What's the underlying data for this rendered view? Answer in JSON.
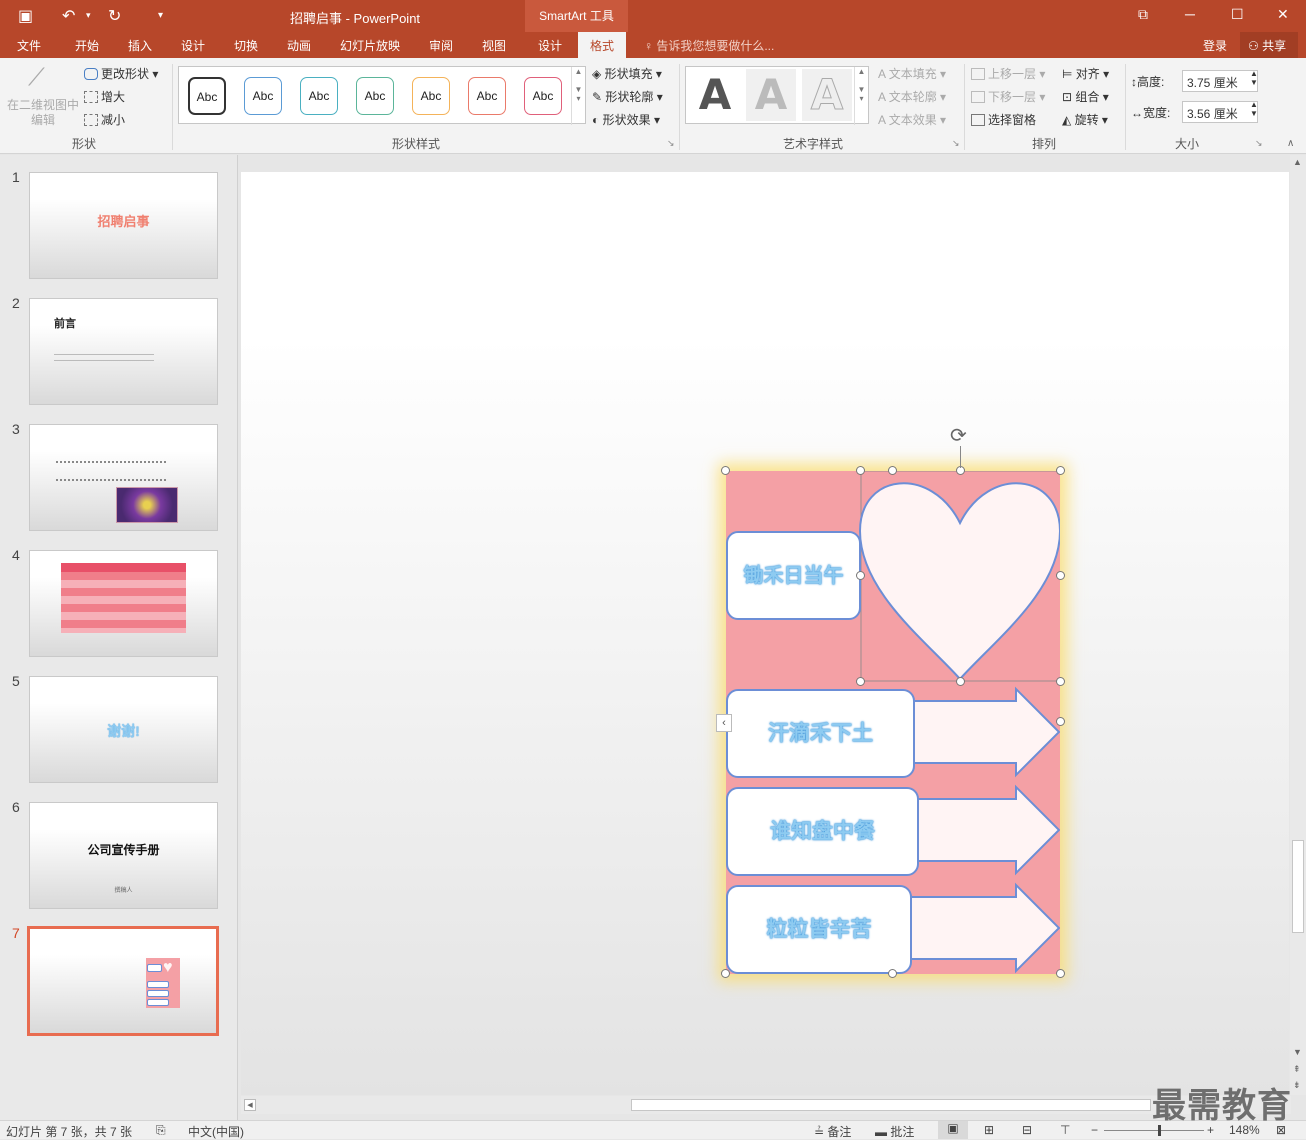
{
  "title": {
    "doc": "招聘启事 - PowerPoint",
    "tools": "SmartArt 工具"
  },
  "tabs": [
    "文件",
    "开始",
    "插入",
    "设计",
    "切换",
    "动画",
    "幻灯片放映",
    "审阅",
    "视图",
    "设计",
    "格式"
  ],
  "tell_me": "告诉我您想要做什么...",
  "login": "登录",
  "share": "共享",
  "ribbon": {
    "shape_group": {
      "edit2d": "在二维视图中编辑",
      "change_shape": "更改形状",
      "enlarge": "增大",
      "shrink": "减小",
      "label": "形状"
    },
    "shape_styles": {
      "sample": "Abc",
      "fill": "形状填充",
      "outline": "形状轮廓",
      "effects": "形状效果",
      "label": "形状样式",
      "colors": [
        "#333333",
        "#5b9bd5",
        "#4ab0c1",
        "#5bb59a",
        "#f4b35a",
        "#ea7a6a",
        "#e0607a"
      ]
    },
    "wordart": {
      "letter": "A",
      "fill": "文本填充",
      "outline": "文本轮廓",
      "effects": "文本效果",
      "label": "艺术字样式"
    },
    "arrange": {
      "forward": "上移一层",
      "backward": "下移一层",
      "selection": "选择窗格",
      "align": "对齐",
      "group": "组合",
      "rotate": "旋转",
      "label": "排列"
    },
    "size": {
      "height_label": "高度:",
      "height": "3.75 厘米",
      "width_label": "宽度:",
      "width": "3.56 厘米",
      "label": "大小"
    }
  },
  "slides": [
    {
      "num": "1",
      "title": "招聘启事"
    },
    {
      "num": "2",
      "title": "前言"
    },
    {
      "num": "3",
      "title": ""
    },
    {
      "num": "4",
      "title": ""
    },
    {
      "num": "5",
      "title": "谢谢!"
    },
    {
      "num": "6",
      "title": "公司宣传手册",
      "sub": "撰稿人"
    },
    {
      "num": "7",
      "title": ""
    }
  ],
  "smartart": {
    "items": [
      "锄禾日当午",
      "汗滴禾下土",
      "谁知盘中餐",
      "粒粒皆辛苦"
    ]
  },
  "status": {
    "slide": "幻灯片 第 7 张，共 7 张",
    "lang": "中文(中国)",
    "notes": "备注",
    "comments": "批注",
    "zoom": "148%"
  },
  "watermark": "最需教育"
}
